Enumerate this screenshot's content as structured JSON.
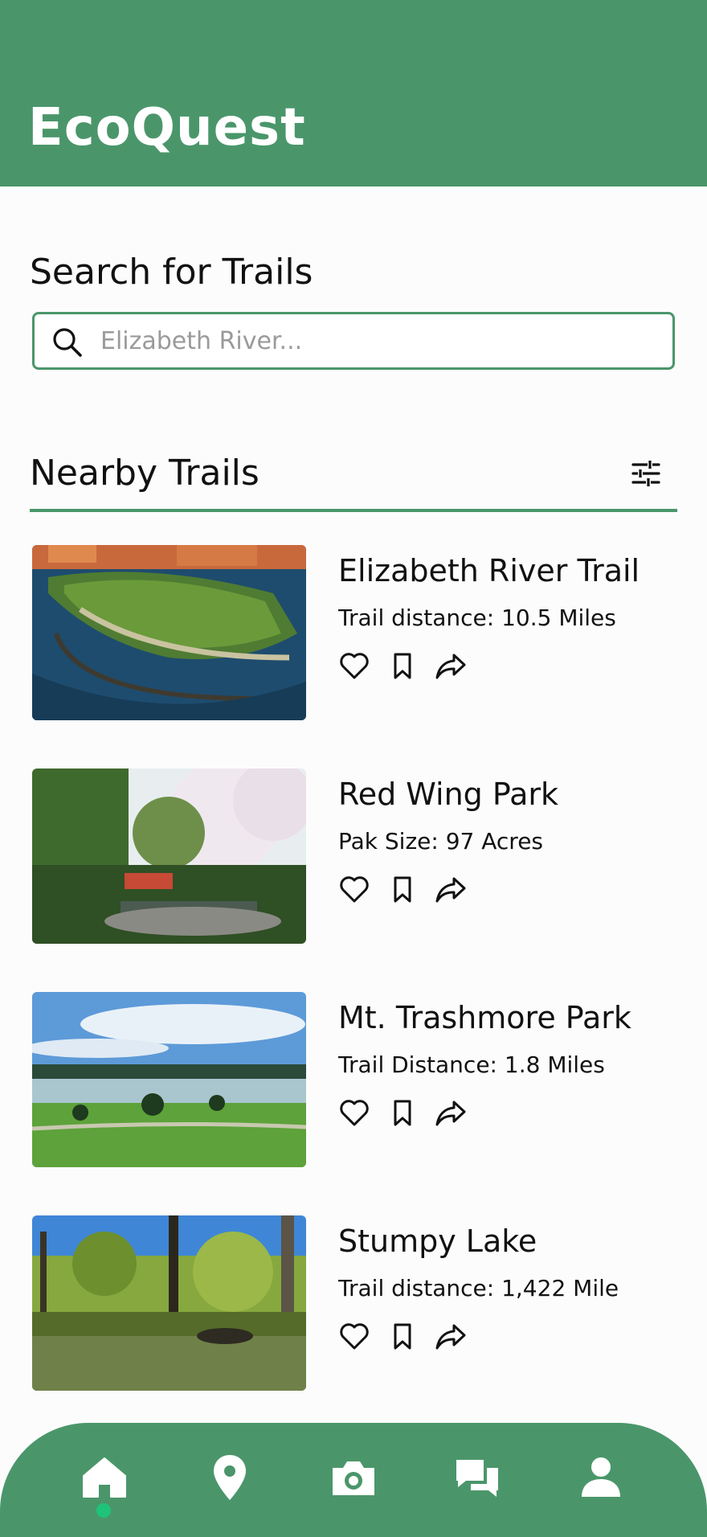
{
  "app": {
    "title": "EcoQuest"
  },
  "search": {
    "heading": "Search for Trails",
    "placeholder": "Elizabeth River..."
  },
  "nearby": {
    "heading": "Nearby Trails"
  },
  "trails": [
    {
      "name": "Elizabeth River Trail",
      "detail": "Trail distance: 10.5 Miles",
      "image": "aerial waterfront park"
    },
    {
      "name": "Red Wing Park",
      "detail": "Pak Size: 97 Acres",
      "image": "park garden with red bridge"
    },
    {
      "name": "Mt. Trashmore Park",
      "detail": "Trail Distance: 1.8 Miles",
      "image": "lake and green lawn"
    },
    {
      "name": "Stumpy Lake",
      "detail": "Trail distance: 1,422 Miles",
      "image": "cypress swamp lake"
    }
  ],
  "icons": {
    "search": "search-icon",
    "filter": "sliders-icon",
    "like": "heart-icon",
    "save": "bookmark-icon",
    "share": "share-icon"
  },
  "nav": {
    "items": [
      "home-icon",
      "map-pin-icon",
      "camera-icon",
      "chat-icon",
      "profile-icon"
    ],
    "active": "home-icon"
  },
  "colors": {
    "primary": "#4a966a",
    "active_dot": "#1fc27a",
    "background": "#fcfcfc"
  }
}
